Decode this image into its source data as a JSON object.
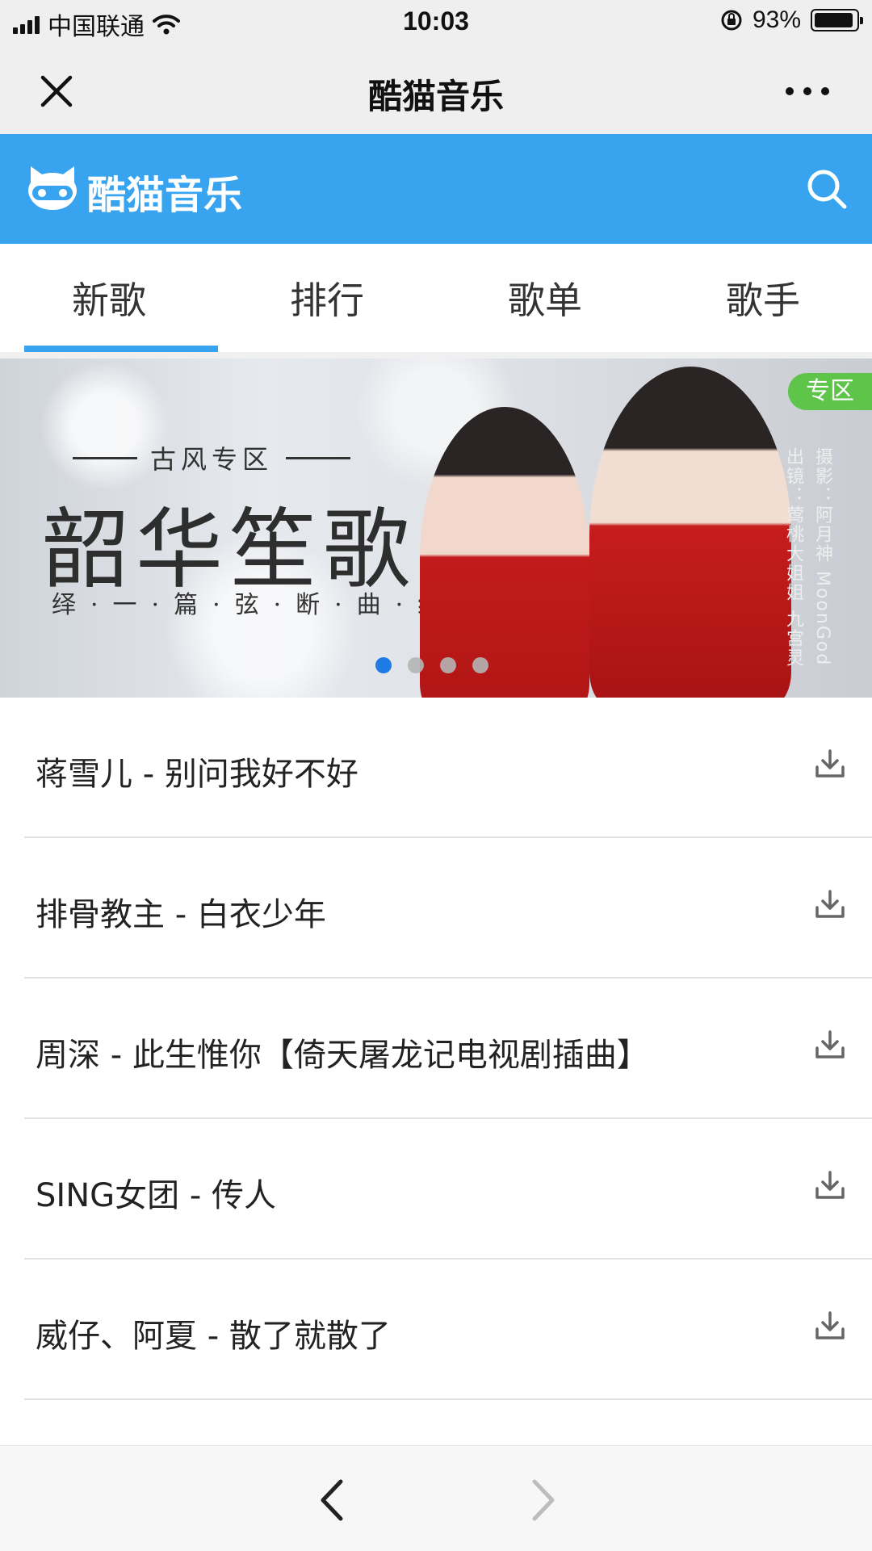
{
  "status_bar": {
    "carrier": "中国联通",
    "time": "10:03",
    "battery_percent": "93%",
    "battery_level": 0.93
  },
  "title_bar": {
    "title": "酷猫音乐",
    "close_icon": "close-icon",
    "more_icon": "more-icon"
  },
  "app_header": {
    "app_name": "酷猫音乐",
    "logo_icon": "cat-logo-icon",
    "search_icon": "search-icon",
    "color": "#38a4ef"
  },
  "tabs": [
    {
      "label": "新歌",
      "active": true
    },
    {
      "label": "排行",
      "active": false
    },
    {
      "label": "歌单",
      "active": false
    },
    {
      "label": "歌手",
      "active": false
    }
  ],
  "banner": {
    "subtitle": "古风专区",
    "title": "韶华笙歌",
    "tagline": "绎·一·篇·弦·断·曲·终",
    "tag": "专区",
    "credit_photo": "摄影：阿月神 MoonGod",
    "credit_model": "出镜：莺桃大姐姐 九宫灵",
    "page_count": 4,
    "active_page": 1
  },
  "songs": [
    {
      "title": "蒋雪儿 - 别问我好不好"
    },
    {
      "title": "排骨教主 - 白衣少年"
    },
    {
      "title": "周深 - 此生惟你【倚天屠龙记电视剧插曲】"
    },
    {
      "title": "SING女团 - 传人"
    },
    {
      "title": "威仔、阿夏 - 散了就散了"
    }
  ],
  "bottom_nav": {
    "back_icon": "back-arrow-icon",
    "forward_icon": "forward-arrow-icon",
    "forward_enabled": false
  }
}
